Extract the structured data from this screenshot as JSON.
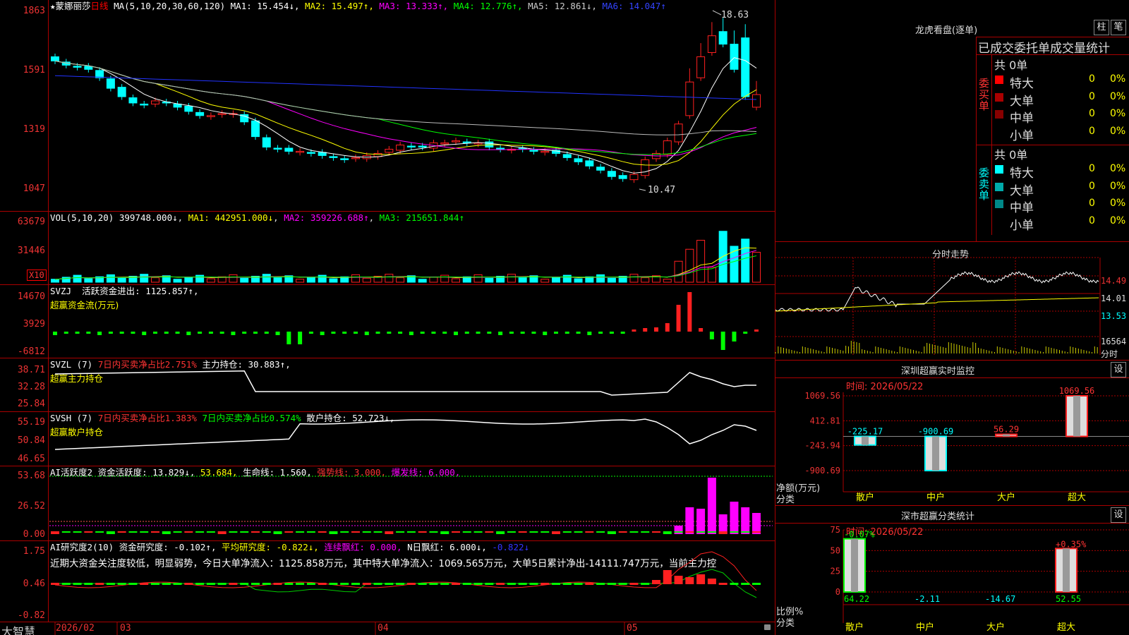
{
  "main": {
    "title": "★蒙娜丽莎",
    "period": "日线",
    "ma_header": "MA(5,10,20,30,60,120)",
    "mas": [
      {
        "label": "MA1: 15.454↓",
        "color": "#ffffff"
      },
      {
        "label": "MA2: 15.497↑",
        "color": "#ffff00"
      },
      {
        "label": "MA3: 13.333↑",
        "color": "#ff00ff"
      },
      {
        "label": "MA4: 12.776↑",
        "color": "#00ff00"
      },
      {
        "label": "MA5: 12.861↓",
        "color": "#cccccc"
      },
      {
        "label": "MA6: 14.047↑",
        "color": "#3344ff"
      }
    ],
    "y_labels": [
      "1863",
      "1591",
      "1319",
      "1047"
    ],
    "high_label": "18.63",
    "low_label": "10.47"
  },
  "vol": {
    "header": "VOL(5,10,20)",
    "value": "399748.000↓",
    "ma1": "MA1: 442951.000↓",
    "ma2": "MA2: 359226.688↑",
    "ma3": "MA3: 215651.844↑",
    "y_labels": [
      "63679",
      "31446"
    ],
    "unit": "X10"
  },
  "svzj": {
    "header": "SVZJ",
    "text": "活跃资金进出: 1125.857↑,",
    "subtitle": "超赢资金流(万元)",
    "y_labels": [
      "14670",
      "3929",
      "-6812"
    ]
  },
  "svzl": {
    "header": "SVZL (7)",
    "pct": "7日内买卖净占比2.751%",
    "hold": "主力持仓: 30.883↑,",
    "subtitle": "超赢主力持仓",
    "y_labels": [
      "38.71",
      "32.28",
      "25.84"
    ]
  },
  "svsh": {
    "header": "SVSH (7)",
    "pct1": "7日内买卖净占比1.383%",
    "pct2": "7日内买卖净占比0.574%",
    "hold": "散户持仓: 52.723↓,",
    "subtitle": "超赢散户持仓",
    "y_labels": [
      "55.19",
      "50.84",
      "46.65"
    ]
  },
  "ai": {
    "header": "AI活跃度2",
    "a": "资金活跃度: 13.829↓,",
    "b": "53.684,",
    "c": "生命线: 1.560,",
    "d": "强势线: 3.000,",
    "e": "爆发线: 6.000,",
    "y_labels": [
      "53.68",
      "26.52",
      "0.00"
    ]
  },
  "research": {
    "header": "AI研究度2(10)",
    "a": "资金研究度: -0.102↑,",
    "b": "平均研究度: -0.822↓,",
    "c": "连续飘红: 0.000,",
    "d": "N日飘红: 6.000↓,",
    "e": "-0.822↓",
    "comment": "近期大资金关注度较低，明显弱势，今日大单净流入：1125.858万元，其中特大单净流入：1069.565万元，大单5日累计净出-14111.747万元，当前主力控",
    "y_labels": [
      "1.75",
      "0.46",
      "-0.82"
    ]
  },
  "xaxis": {
    "brand": "大智慧",
    "labels": [
      "2026/02",
      "03",
      "04",
      "05"
    ]
  },
  "lhb": {
    "title": "龙虎看盘(逐单)",
    "btn1": "柱",
    "btn2": "笔",
    "tabs": "已成交委托单成交量统计",
    "buy": {
      "side": "委买单",
      "total": "共 0单",
      "rows": [
        {
          "name": "特大",
          "n": "0",
          "p": "0%"
        },
        {
          "name": "大单",
          "n": "0",
          "p": "0%"
        },
        {
          "name": "中单",
          "n": "0",
          "p": "0%"
        },
        {
          "name": "小单",
          "n": "0",
          "p": "0%"
        }
      ]
    },
    "sell": {
      "side": "委卖单",
      "total": "共 0单",
      "rows": [
        {
          "name": "特大",
          "n": "0",
          "p": "0%"
        },
        {
          "name": "大单",
          "n": "0",
          "p": "0%"
        },
        {
          "name": "中单",
          "n": "0",
          "p": "0%"
        },
        {
          "name": "小单",
          "n": "0",
          "p": "0%"
        }
      ]
    },
    "colors": {
      "buy": [
        "#ff0000",
        "#aa0000",
        "#880000"
      ],
      "sell": [
        "#00ffff",
        "#00aaaa",
        "#008888"
      ]
    }
  },
  "intraday": {
    "title": "分时走势",
    "y_labels": [
      "14.49",
      "14.01",
      "13.53",
      "16564"
    ],
    "unit": "分时"
  },
  "sz_monitor": {
    "title": "深圳超赢实时监控",
    "btn": "设",
    "time": "时间: 2026/05/22",
    "ylabel": "净额(万元)",
    "xlabel": "分类",
    "y_labels": [
      "1069.56",
      "412.81",
      "-243.94",
      "-900.69"
    ],
    "chart_data": {
      "type": "bar",
      "categories": [
        "散户",
        "中户",
        "大户",
        "超大"
      ],
      "values": [
        -225.17,
        -900.69,
        56.29,
        1069.56
      ],
      "labels": [
        "-225.17",
        "-900.69",
        "56.29",
        "1069.56"
      ],
      "ylim": [
        -900.69,
        1069.56
      ]
    }
  },
  "sz_class": {
    "title": "深市超赢分类统计",
    "btn": "设",
    "time": "时间: 2026/05/22",
    "ylabel": "比例%",
    "xlabel": "分类",
    "y_labels": [
      "75",
      "50",
      "25",
      "0"
    ],
    "chart_data": {
      "type": "bar",
      "categories": [
        "散户",
        "中户",
        "大户",
        "超大"
      ],
      "values": [
        64.22,
        -2.11,
        -14.67,
        52.55
      ],
      "top_labels": [
        "-0.07%",
        "",
        "",
        "+0.35%"
      ],
      "bottom_labels": [
        "64.22",
        "-2.11",
        "-14.67",
        "52.55"
      ],
      "ylim": [
        0,
        75
      ]
    }
  }
}
